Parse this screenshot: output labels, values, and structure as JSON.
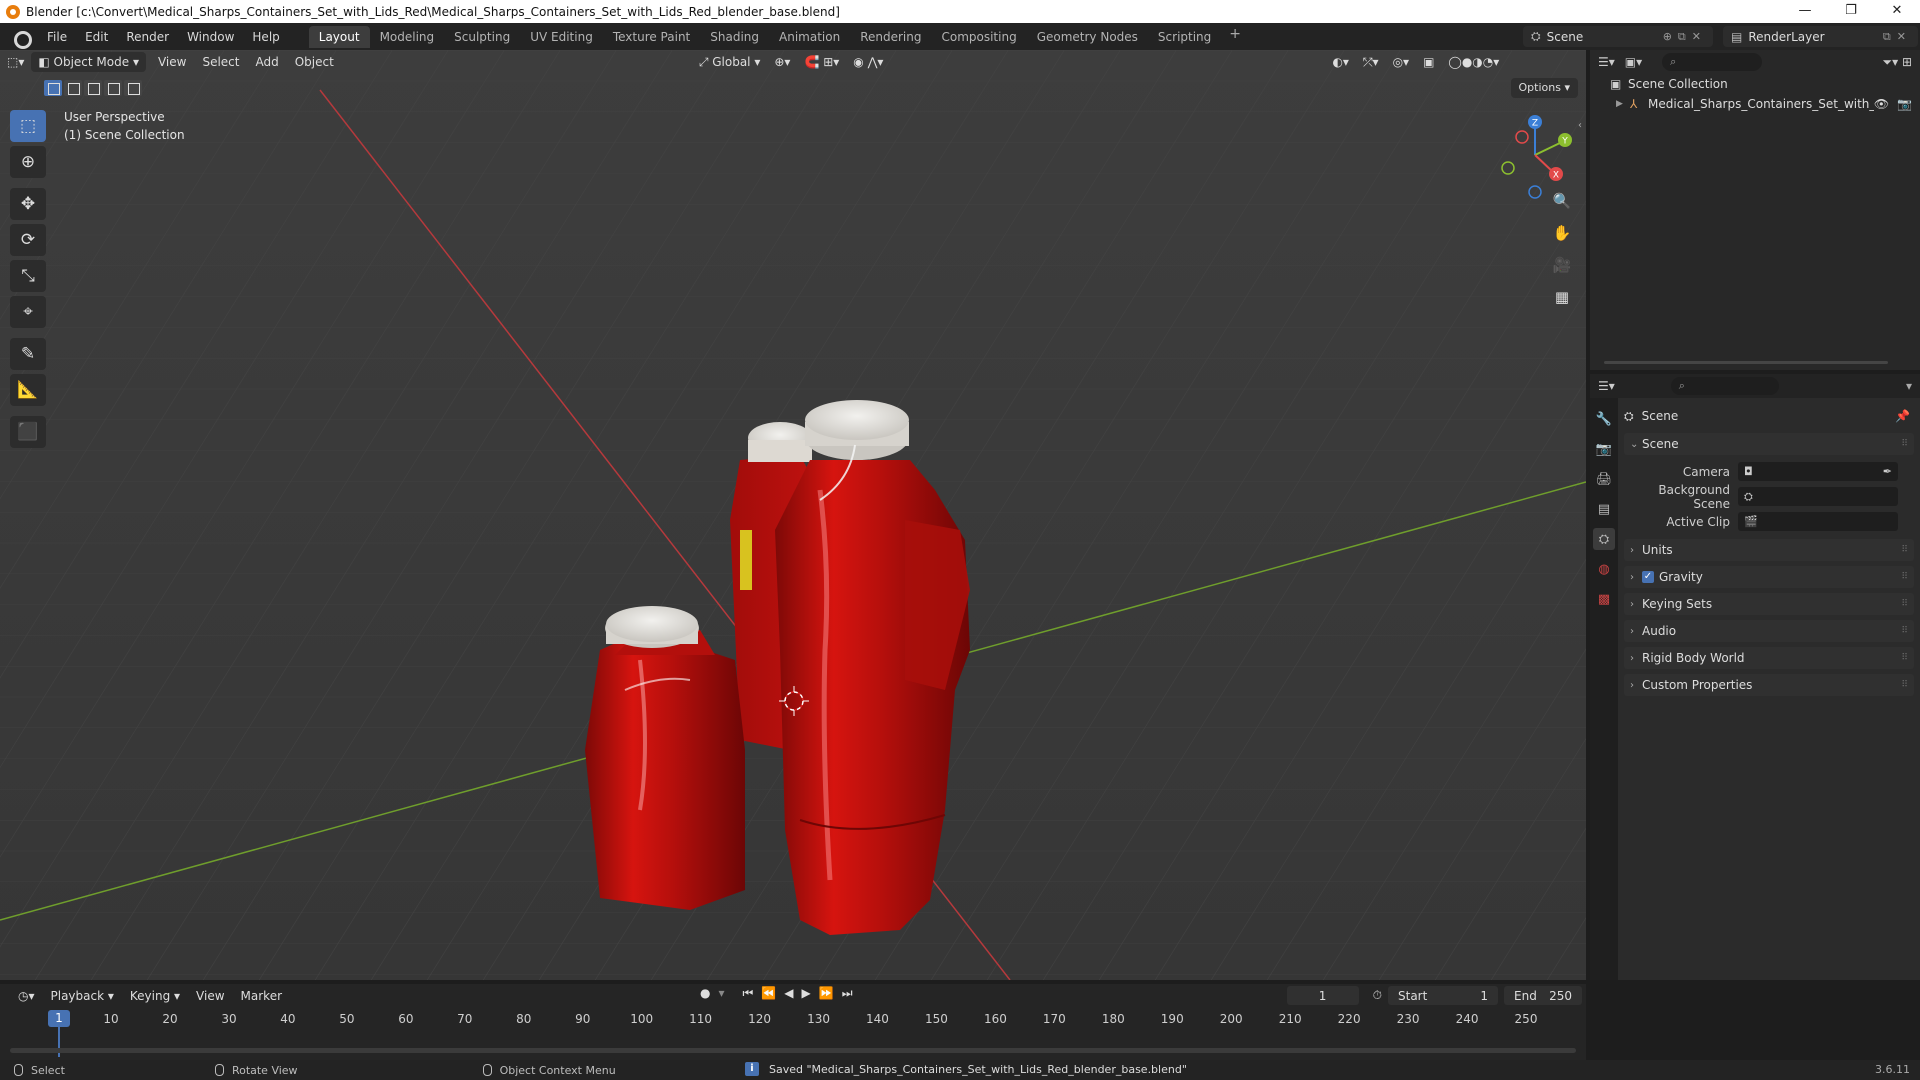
{
  "window": {
    "title": "Blender [c:\\Convert\\Medical_Sharps_Containers_Set_with_Lids_Red\\Medical_Sharps_Containers_Set_with_Lids_Red_blender_base.blend]",
    "minimize": "—",
    "maximize": "❐",
    "close": "✕"
  },
  "menubar": {
    "items": [
      "File",
      "Edit",
      "Render",
      "Window",
      "Help"
    ],
    "workspaces": [
      "Layout",
      "Modeling",
      "Sculpting",
      "UV Editing",
      "Texture Paint",
      "Shading",
      "Animation",
      "Rendering",
      "Compositing",
      "Geometry Nodes",
      "Scripting"
    ],
    "add_workspace": "+",
    "scene": "Scene",
    "view_layer": "RenderLayer"
  },
  "viewport": {
    "mode": "Object Mode",
    "menus": [
      "View",
      "Select",
      "Add",
      "Object"
    ],
    "orientation": "Global",
    "options": "Options",
    "perspective": "User Perspective",
    "collection": "(1) Scene Collection",
    "gizmo_axes": {
      "x": "X",
      "y": "Y",
      "z": "Z"
    }
  },
  "outliner": {
    "root": "Scene Collection",
    "object": "Medical_Sharps_Containers_Set_with_Li"
  },
  "properties": {
    "context": "Scene",
    "scene_panel": "Scene",
    "camera_label": "Camera",
    "bg_scene_label": "Background Scene",
    "active_clip_label": "Active Clip",
    "panels": [
      "Units",
      "Gravity",
      "Keying Sets",
      "Audio",
      "Rigid Body World",
      "Custom Properties"
    ]
  },
  "timeline": {
    "menus": [
      "Playback",
      "Keying",
      "View",
      "Marker"
    ],
    "current_frame": "1",
    "start_label": "Start",
    "start": "1",
    "end_label": "End",
    "end": "250",
    "ticks": [
      "10",
      "20",
      "30",
      "40",
      "50",
      "60",
      "70",
      "80",
      "90",
      "100",
      "110",
      "120",
      "130",
      "140",
      "150",
      "160",
      "170",
      "180",
      "190",
      "200",
      "210",
      "220",
      "230",
      "240",
      "250"
    ],
    "ruler_current": "1"
  },
  "statusbar": {
    "select": "Select",
    "rotate": "Rotate View",
    "context_menu": "Object Context Menu",
    "message": "Saved \"Medical_Sharps_Containers_Set_with_Lids_Red_blender_base.blend\"",
    "version": "3.6.11"
  },
  "colors": {
    "accent": "#4772b3",
    "container_red": "#c8100e",
    "lid": "#e6e4df",
    "x_axis": "#b5393c",
    "y_axis": "#6f9e2c"
  }
}
